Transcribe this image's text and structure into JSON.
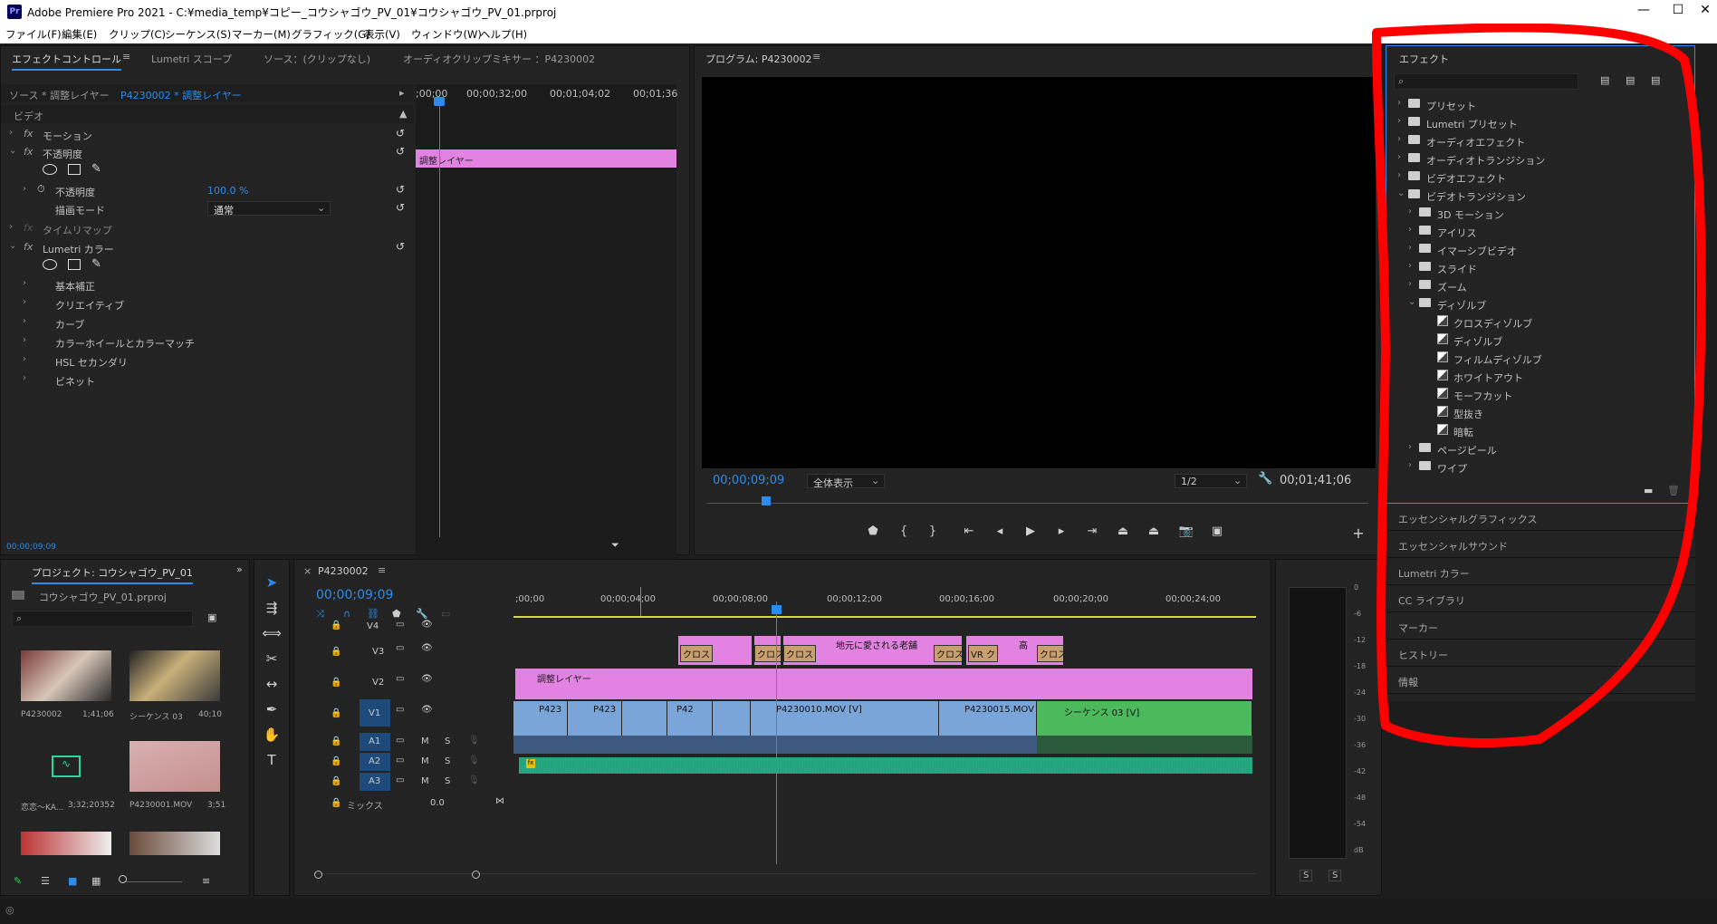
{
  "window": {
    "title": "Adobe Premiere Pro 2021 - C:¥media_temp¥コピー_コウシャゴウ_PV_01¥コウシャゴウ_PV_01.prproj",
    "app_badge": "Pr"
  },
  "menu": [
    "ファイル(F)",
    "編集(E)",
    "クリップ(C)",
    "シーケンス(S)",
    "マーカー(M)",
    "グラフィック(G)",
    "表示(V)",
    "ウィンドウ(W)",
    "ヘルプ(H)"
  ],
  "effect_controls": {
    "tabs": [
      "エフェクトコントロール",
      "Lumetri スコープ",
      "ソース：(クリップなし)",
      "オーディオクリップミキサー ：P4230002"
    ],
    "source_label": "ソース * 調整レイヤー",
    "sequence_label": "P4230002 * 調整レイヤー",
    "timecodes": [
      ";00;00",
      "00;00;32;00",
      "00;01;04;02",
      "00;01;36"
    ],
    "clip_label": "調整レイヤー",
    "video_header": "ビデオ",
    "rows": {
      "motion": "モーション",
      "opacity": "不透明度",
      "opacity_value_label": "不透明度",
      "opacity_value": "100.0 %",
      "blend_mode_label": "描画モード",
      "blend_mode_value": "通常",
      "time_remap": "タイムリマップ",
      "lumetri": "Lumetri カラー",
      "basic": "基本補正",
      "creative": "クリエイティブ",
      "curves": "カーブ",
      "wheels": "カラーホイールとカラーマッチ",
      "hsl": "HSL セカンダリ",
      "vignette": "ビネット"
    },
    "footer_timecode": "00;00;09;09"
  },
  "program": {
    "title": "プログラム: P4230002",
    "timecode": "00;00;09;09",
    "zoom": "全体表示",
    "resolution": "1/2",
    "duration": "00;01;41;06"
  },
  "effects_panel": {
    "title": "エフェクト",
    "items": [
      {
        "label": "プリセット",
        "level": 0,
        "type": "folder",
        "open": false
      },
      {
        "label": "Lumetri プリセット",
        "level": 0,
        "type": "folder",
        "open": false
      },
      {
        "label": "オーディオエフェクト",
        "level": 0,
        "type": "folder",
        "open": false
      },
      {
        "label": "オーディオトランジション",
        "level": 0,
        "type": "folder",
        "open": false
      },
      {
        "label": "ビデオエフェクト",
        "level": 0,
        "type": "folder",
        "open": false
      },
      {
        "label": "ビデオトランジション",
        "level": 0,
        "type": "folder",
        "open": true
      },
      {
        "label": "3D モーション",
        "level": 1,
        "type": "folder",
        "open": false
      },
      {
        "label": "アイリス",
        "level": 1,
        "type": "folder",
        "open": false
      },
      {
        "label": "イマーシブビデオ",
        "level": 1,
        "type": "folder",
        "open": false
      },
      {
        "label": "スライド",
        "level": 1,
        "type": "folder",
        "open": false
      },
      {
        "label": "ズーム",
        "level": 1,
        "type": "folder",
        "open": false
      },
      {
        "label": "ディゾルブ",
        "level": 1,
        "type": "folder",
        "open": true
      },
      {
        "label": "クロスディゾルブ",
        "level": 2,
        "type": "transition"
      },
      {
        "label": "ディゾルブ",
        "level": 2,
        "type": "transition"
      },
      {
        "label": "フィルムディゾルブ",
        "level": 2,
        "type": "transition"
      },
      {
        "label": "ホワイトアウト",
        "level": 2,
        "type": "transition"
      },
      {
        "label": "モーフカット",
        "level": 2,
        "type": "transition"
      },
      {
        "label": "型抜き",
        "level": 2,
        "type": "transition"
      },
      {
        "label": "暗転",
        "level": 2,
        "type": "transition"
      },
      {
        "label": "ページピール",
        "level": 1,
        "type": "folder",
        "open": false
      },
      {
        "label": "ワイプ",
        "level": 1,
        "type": "folder",
        "open": false
      }
    ],
    "collapsed_panels": [
      "エッセンシャルグラフィックス",
      "エッセンシャルサウンド",
      "Lumetri カラー",
      "CC ライブラリ",
      "マーカー",
      "ヒストリー",
      "情報"
    ]
  },
  "project": {
    "title": "プロジェクト: コウシャゴウ_PV_01",
    "file": "コウシャゴウ_PV_01.prproj",
    "items": [
      {
        "name": "P4230002",
        "duration": "1;41;06"
      },
      {
        "name": "シーケンス 03",
        "duration": "40;10"
      },
      {
        "name": "恋恋〜KA...",
        "duration": "3;32;20352"
      },
      {
        "name": "P4230001.MOV",
        "duration": "3;51"
      }
    ]
  },
  "timeline": {
    "sequence": "P4230002",
    "timecode": "00;00;09;09",
    "ruler": [
      ";00;00",
      "00;00;04;00",
      "00;00;08;00",
      "00;00;12;00",
      "00;00;16;00",
      "00;00;20;00",
      "00;00;24;00"
    ],
    "tracks_video": [
      "V4",
      "V3",
      "V2",
      "V1"
    ],
    "tracks_audio": [
      "A1",
      "A2",
      "A3"
    ],
    "mix_label": "ミックス",
    "mix_value": "0.0",
    "v3_clips": [
      "クロス",
      "クロス",
      "クロス",
      "地元に愛される老舗",
      "クロス",
      "VR ク",
      "高",
      "クロス"
    ],
    "v2_clip": "調整レイヤー",
    "v1_clips": [
      "P423",
      "P423",
      "P42",
      "P4230010.MOV [V]",
      "P4230015.MOV",
      "シーケンス 03 [V]"
    ],
    "m_label": "M",
    "s_label": "S"
  },
  "audio_meter": {
    "scale": [
      "0",
      "-6",
      "-12",
      "-18",
      "-24",
      "-30",
      "-36",
      "-42",
      "-48",
      "-54",
      "dB"
    ],
    "buttons": [
      "S",
      "S"
    ]
  },
  "colors": {
    "accent": "#2d8ceb",
    "pink": "#e283e1",
    "blue_clip": "#7aa5d8",
    "green_clip": "#4cba5c",
    "audio": "#2fd3a0",
    "annotation": "#ff0000"
  }
}
